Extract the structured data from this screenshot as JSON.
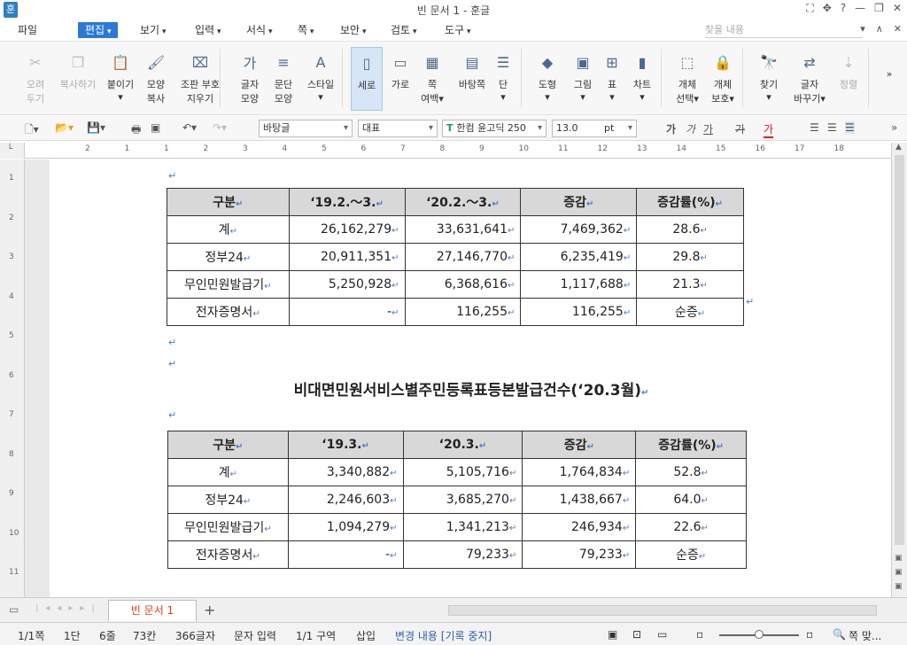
{
  "window": {
    "title": "빈 문서 1 - 훈글",
    "app_icon": "훈",
    "controls": [
      "⛶",
      "✥",
      "?",
      "—",
      "❐",
      "✕"
    ]
  },
  "menu": {
    "items": [
      "파일",
      "편집",
      "보기",
      "입력",
      "서식",
      "쪽",
      "보안",
      "검토",
      "도구"
    ],
    "active": "편집",
    "search_placeholder": "찾을 내용",
    "right_controls": [
      "▾",
      "∧",
      "✕"
    ]
  },
  "ribbon": {
    "buttons": [
      {
        "label1": "오려",
        "label2": "두기",
        "icon": "scissors-icon",
        "glyph": "✂",
        "disabled": true
      },
      {
        "label1": "복사하기",
        "label2": "",
        "icon": "copy-icon",
        "glyph": "❐",
        "disabled": true
      },
      {
        "label1": "붙이기",
        "label2": "▾",
        "icon": "paste-icon",
        "glyph": "📋",
        "disabled": false
      },
      {
        "label1": "모양",
        "label2": "복사",
        "icon": "format-painter-icon",
        "glyph": "🖌",
        "disabled": false
      },
      {
        "label1": "조판 부호",
        "label2": "지우기",
        "icon": "clear-codes-icon",
        "glyph": "⌧",
        "disabled": false
      },
      {
        "label1": "글자",
        "label2": "모양",
        "icon": "char-shape-icon",
        "glyph": "가",
        "disabled": false
      },
      {
        "label1": "문단",
        "label2": "모양",
        "icon": "para-shape-icon",
        "glyph": "≡",
        "disabled": false
      },
      {
        "label1": "스타일",
        "label2": "▾",
        "icon": "style-icon",
        "glyph": "A",
        "disabled": false
      },
      {
        "label1": "세로",
        "label2": "",
        "icon": "portrait-icon",
        "glyph": "▯",
        "disabled": false,
        "selected": true
      },
      {
        "label1": "가로",
        "label2": "",
        "icon": "landscape-icon",
        "glyph": "▭",
        "disabled": false
      },
      {
        "label1": "쪽",
        "label2": "여백▾",
        "icon": "margin-icon",
        "glyph": "▦",
        "disabled": false
      },
      {
        "label1": "바탕쪽",
        "label2": "",
        "icon": "master-page-icon",
        "glyph": "▤",
        "disabled": false
      },
      {
        "label1": "단",
        "label2": "▾",
        "icon": "columns-icon",
        "glyph": "☰",
        "disabled": false
      },
      {
        "label1": "도형",
        "label2": "▾",
        "icon": "shape-icon",
        "glyph": "◆",
        "disabled": false
      },
      {
        "label1": "그림",
        "label2": "▾",
        "icon": "picture-icon",
        "glyph": "▣",
        "disabled": false
      },
      {
        "label1": "표",
        "label2": "▾",
        "icon": "table-icon",
        "glyph": "⊞",
        "disabled": false
      },
      {
        "label1": "차트",
        "label2": "▾",
        "icon": "chart-icon",
        "glyph": "▮",
        "disabled": false
      },
      {
        "label1": "개체",
        "label2": "선택▾",
        "icon": "object-select-icon",
        "glyph": "⬚",
        "disabled": false
      },
      {
        "label1": "개체",
        "label2": "보호▾",
        "icon": "object-protect-icon",
        "glyph": "🔒",
        "disabled": false
      },
      {
        "label1": "찾기",
        "label2": "▾",
        "icon": "find-icon",
        "glyph": "🔭",
        "disabled": false
      },
      {
        "label1": "글자",
        "label2": "바꾸기▾",
        "icon": "replace-icon",
        "glyph": "⇄",
        "disabled": false
      },
      {
        "label1": "정렬",
        "label2": "",
        "icon": "sort-icon",
        "glyph": "⇣",
        "disabled": true
      }
    ],
    "more": "»"
  },
  "format_bar": {
    "style_value": "바탕글",
    "lang_value": "대표",
    "font_value": "한컴 윤고딕 250",
    "size_value": "13.0",
    "size_unit": "pt",
    "bold": "가",
    "italic": "가",
    "underline": "가",
    "strike": "가",
    "color": "가"
  },
  "ruler": {
    "marks": [
      "2",
      "1",
      "1",
      "2",
      "3",
      "4",
      "5",
      "6",
      "7",
      "8",
      "9",
      "10",
      "11",
      "12",
      "13",
      "14",
      "15",
      "16",
      "17",
      "18"
    ],
    "vmarks": [
      "1",
      "2",
      "3",
      "4",
      "5",
      "6",
      "7",
      "8",
      "9",
      "10",
      "11"
    ]
  },
  "document": {
    "table1": {
      "header": [
        "구분",
        "‘19.2.～3.",
        "‘20.2.～3.",
        "증감",
        "증감률(%)"
      ],
      "rows": [
        [
          "계",
          "26,162,279",
          "33,631,641",
          "7,469,362",
          "28.6"
        ],
        [
          "정부24",
          "20,911,351",
          "27,146,770",
          "6,235,419",
          "29.8"
        ],
        [
          "무인민원발급기",
          "5,250,928",
          "6,368,616",
          "1,117,688",
          "21.3"
        ],
        [
          "전자증명서",
          "-",
          "116,255",
          "116,255",
          "순증"
        ]
      ]
    },
    "title2": "비대면민원서비스별주민등록표등본발급건수(‘20.3월)",
    "table2": {
      "header": [
        "구분",
        "‘19.3.",
        "‘20.3.",
        "증감",
        "증감률(%)"
      ],
      "rows": [
        [
          "계",
          "3,340,882",
          "5,105,716",
          "1,764,834",
          "52.8"
        ],
        [
          "정부24",
          "2,246,603",
          "3,685,270",
          "1,438,667",
          "64.0"
        ],
        [
          "무인민원발급기",
          "1,094,279",
          "1,341,213",
          "246,934",
          "22.6"
        ],
        [
          "전자증명서",
          "-",
          "79,233",
          "79,233",
          "순증"
        ]
      ]
    },
    "para_mark": "↵"
  },
  "tabs": {
    "doc_tab": "빈 문서 1",
    "add": "+"
  },
  "status": {
    "page": "1/1쪽",
    "column": "1단",
    "line": "6줄",
    "col": "73칸",
    "chars": "366글자",
    "input_mode": "문자 입력",
    "section": "1/1 구역",
    "insert": "삽입",
    "track": "변경 내용 [기록 중지]",
    "zoom": "쪽 맞..."
  }
}
